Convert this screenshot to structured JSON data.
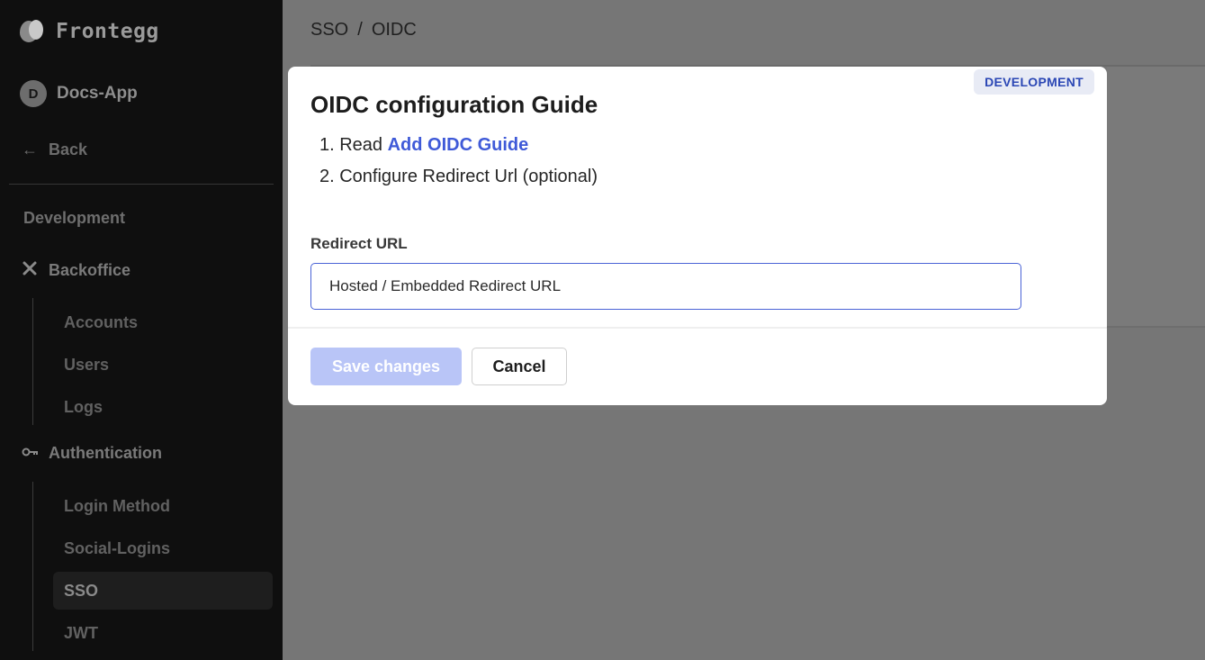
{
  "brand": {
    "name": "Frontegg"
  },
  "app": {
    "initial": "D",
    "name": "Docs-App"
  },
  "nav": {
    "back_label": "Back",
    "section_label": "Development",
    "backoffice": {
      "title": "Backoffice",
      "icon": "tools-icon",
      "items": [
        "Accounts",
        "Users",
        "Logs"
      ]
    },
    "authentication": {
      "title": "Authentication",
      "icon": "key-icon",
      "items": [
        "Login Method",
        "Social-Logins",
        "SSO",
        "JWT"
      ],
      "active": "SSO"
    }
  },
  "breadcrumb": {
    "parent": "SSO",
    "separator": "/",
    "current": "OIDC"
  },
  "modal": {
    "badge": "DEVELOPMENT",
    "title": "OIDC configuration Guide",
    "step1_prefix": "1. Read ",
    "step1_link": "Add OIDC Guide",
    "step2": "2. Configure Redirect Url (optional)",
    "field_label": "Redirect URL",
    "field_value": "Hosted / Embedded Redirect URL",
    "save_label": "Save changes",
    "cancel_label": "Cancel"
  },
  "colors": {
    "accent": "#3f5ad8",
    "save_disabled": "#b9c5f7",
    "sidebar_bg": "#0f0f0f",
    "overlay_bg": "#767676"
  }
}
